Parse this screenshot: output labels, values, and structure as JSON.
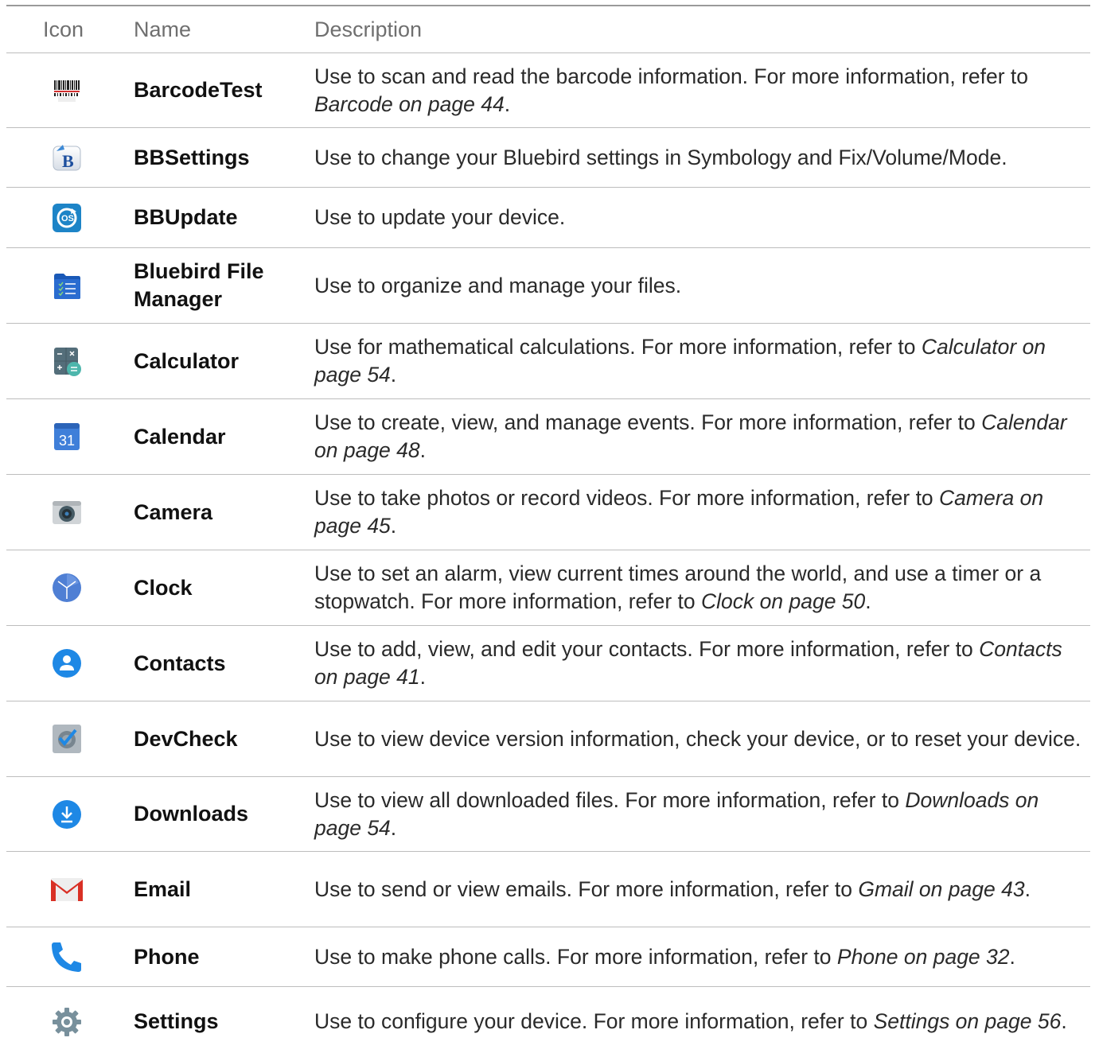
{
  "header": {
    "icon": "Icon",
    "name": "Name",
    "description": "Description"
  },
  "rows": [
    {
      "icon": "barcode-icon",
      "name": "BarcodeTest",
      "desc": "Use to scan and read the barcode information. For more information, refer to ",
      "ref": "Barcode on page 44",
      "tail": "."
    },
    {
      "icon": "bbsettings-icon",
      "name": "BBSettings",
      "desc": "Use to change your Bluebird settings in Symbology and Fix/Volume/Mode.",
      "ref": "",
      "tail": ""
    },
    {
      "icon": "bbupdate-icon",
      "name": "BBUpdate",
      "desc": "Use to update your device.",
      "ref": "",
      "tail": ""
    },
    {
      "icon": "file-manager-icon",
      "name": "Bluebird File Manager",
      "desc": "Use to organize and manage your files.",
      "ref": "",
      "tail": ""
    },
    {
      "icon": "calculator-icon",
      "name": "Calculator",
      "desc": "Use for mathematical calculations. For more information, refer to ",
      "ref": "Calculator on page 54",
      "tail": "."
    },
    {
      "icon": "calendar-icon",
      "name": "Calendar",
      "desc": "Use to create, view, and manage events. For more information, refer to ",
      "ref": "Calendar on page 48",
      "tail": "."
    },
    {
      "icon": "camera-icon",
      "name": "Camera",
      "desc": "Use to take photos or record videos. For more information, refer to ",
      "ref": "Camera on page 45",
      "tail": "."
    },
    {
      "icon": "clock-icon",
      "name": "Clock",
      "desc": "Use to set an alarm, view current times around the world, and use a timer or a stopwatch. For more information, refer to ",
      "ref": "Clock on page 50",
      "tail": "."
    },
    {
      "icon": "contacts-icon",
      "name": "Contacts",
      "desc": "Use to add, view, and edit your contacts. For more information, refer to ",
      "ref": "Contacts on page 41",
      "tail": "."
    },
    {
      "icon": "devcheck-icon",
      "name": "DevCheck",
      "desc": "Use to view device version information, check your device, or to reset your device.",
      "ref": "",
      "tail": ""
    },
    {
      "icon": "downloads-icon",
      "name": "Downloads",
      "desc": "Use to view all downloaded files. For more information, refer to ",
      "ref": "Downloads on page 54",
      "tail": "."
    },
    {
      "icon": "email-icon",
      "name": "Email",
      "desc": "Use to send or view emails. For more information, refer to ",
      "ref": "Gmail on page 43",
      "tail": "."
    },
    {
      "icon": "phone-icon",
      "name": "Phone",
      "desc": "Use to make phone calls. For more information, refer to ",
      "ref": "Phone on page 32",
      "tail": "."
    },
    {
      "icon": "settings-icon",
      "name": "Settings",
      "desc": "Use to configure your device. For more information, refer to ",
      "ref": "Settings on page 56",
      "tail": "."
    }
  ],
  "colors": {
    "rule": "#bdbdbd",
    "header_text": "#6f6f6f",
    "name_text": "#111111",
    "desc_text": "#2a2a2a"
  }
}
